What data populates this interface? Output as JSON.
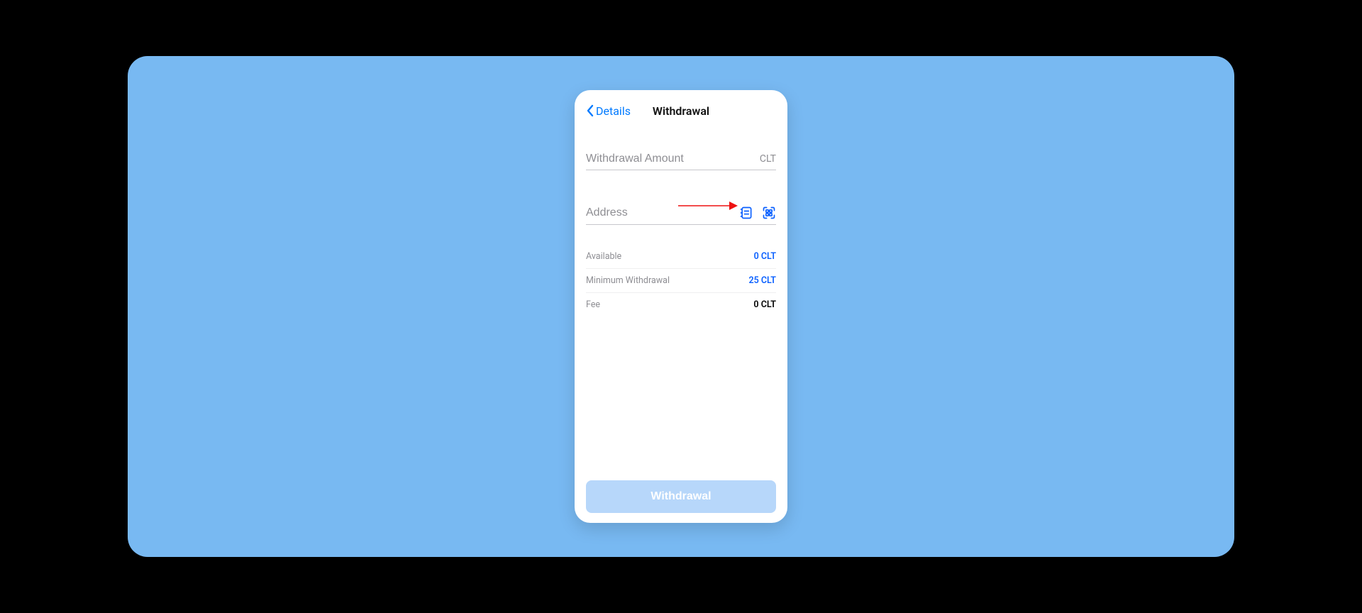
{
  "nav": {
    "back_label": "Details",
    "title": "Withdrawal"
  },
  "fields": {
    "amount_placeholder": "Withdrawal Amount",
    "amount_suffix": "CLT",
    "address_placeholder": "Address"
  },
  "info": {
    "available_label": "Available",
    "available_value": "0 CLT",
    "min_label": "Minimum Withdrawal",
    "min_value": "25 CLT",
    "fee_label": "Fee",
    "fee_value": "0 CLT"
  },
  "cta_label": "Withdrawal",
  "colors": {
    "accent": "#007aff",
    "link_blue": "#0a60ff",
    "bg": "#78b9f2",
    "arrow_red": "#e11"
  }
}
